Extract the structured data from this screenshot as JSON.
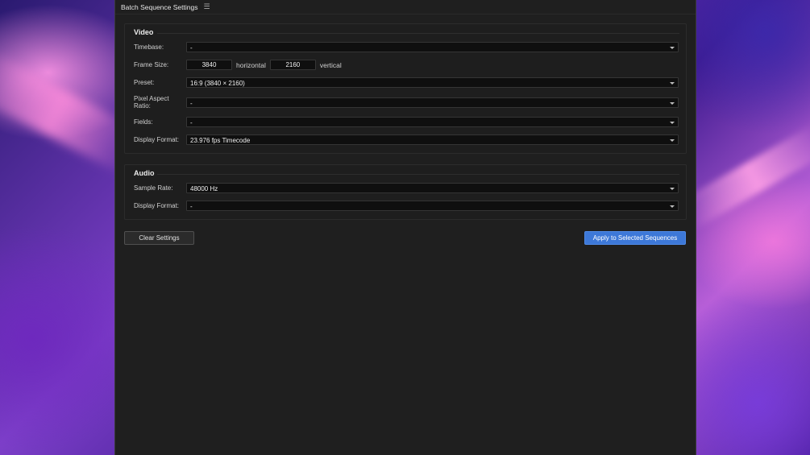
{
  "panel": {
    "title": "Batch Sequence Settings",
    "menu_icon": "hamburger-menu-icon"
  },
  "video": {
    "heading": "Video",
    "timebase": {
      "label": "Timebase:",
      "value": "-"
    },
    "frame_size": {
      "label": "Frame Size:",
      "horizontal_value": "3840",
      "horizontal_unit": "horizontal",
      "vertical_value": "2160",
      "vertical_unit": "vertical"
    },
    "preset": {
      "label": "Preset:",
      "value": "16:9 (3840 × 2160)"
    },
    "pixel_aspect_ratio": {
      "label_line1": "Pixel Aspect",
      "label_line2": "Ratio:",
      "value": "-"
    },
    "fields": {
      "label": "Fields:",
      "value": "-"
    },
    "display_format": {
      "label": "Display Format:",
      "value": "23.976 fps Timecode"
    }
  },
  "audio": {
    "heading": "Audio",
    "sample_rate": {
      "label": "Sample Rate:",
      "value": "48000 Hz"
    },
    "display_format": {
      "label": "Display Format:",
      "value": "-"
    }
  },
  "buttons": {
    "clear": "Clear Settings",
    "apply": "Apply to Selected Sequences"
  },
  "colors": {
    "panel_bg": "#1f1f1f",
    "field_bg": "#0f0f0f",
    "accent": "#3d78d8"
  }
}
